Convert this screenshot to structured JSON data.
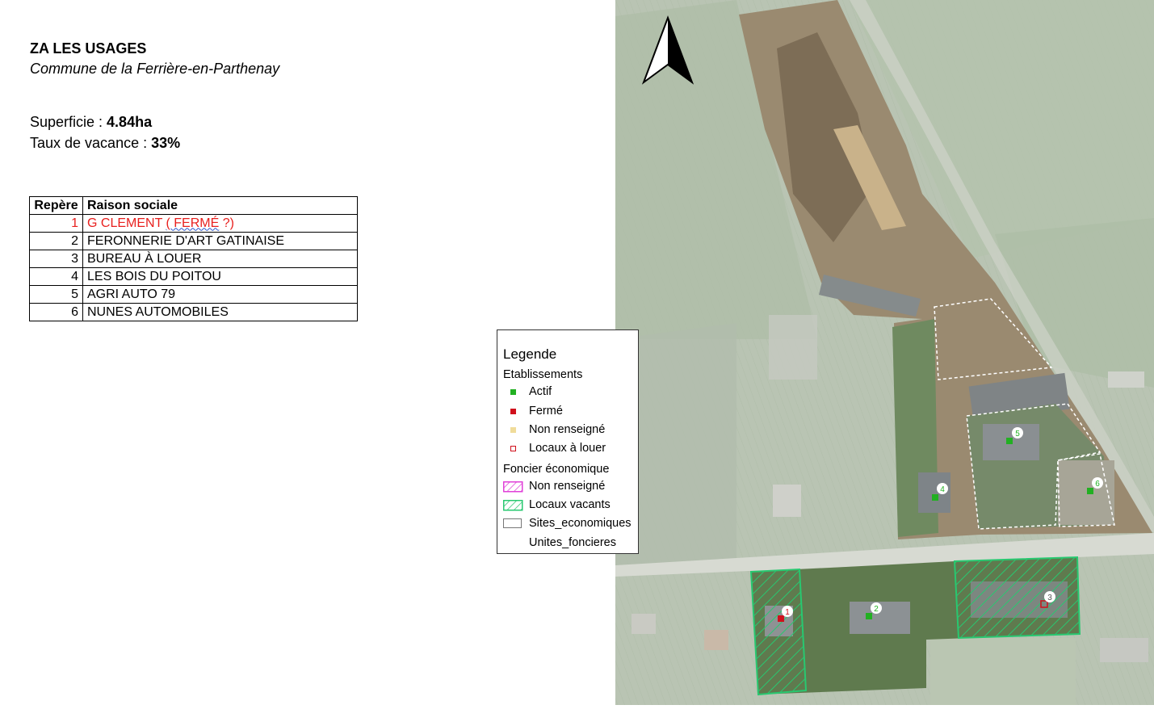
{
  "header": {
    "title": "ZA LES USAGES",
    "subtitle": "Commune de la Ferrière-en-Parthenay"
  },
  "stats": {
    "area_label": "Superficie : ",
    "area_value": "4.84ha",
    "vacancy_label": "Taux de vacance : ",
    "vacancy_value": "33%"
  },
  "table": {
    "headers": [
      "Repère",
      "Raison sociale"
    ],
    "rows": [
      {
        "num": "1",
        "name_part1": "G CLEMENT ",
        "name_part2": "( FERMÉ",
        "name_part3": " ?)"
      },
      {
        "num": "2",
        "name": "FERONNERIE D'ART GATINAISE"
      },
      {
        "num": "3",
        "name": "BUREAU À LOUER"
      },
      {
        "num": "4",
        "name": "LES BOIS DU POITOU"
      },
      {
        "num": "5",
        "name": "AGRI AUTO 79"
      },
      {
        "num": "6",
        "name": "NUNES AUTOMOBILES"
      }
    ]
  },
  "legend": {
    "title": "Legende",
    "section_establishments": "Etablissements",
    "active": "Actif",
    "closed": "Fermé",
    "not_informed": "Non renseigné",
    "premises_to_let": "Locaux à louer",
    "section_land": "Foncier économique",
    "land_not_informed": "Non renseigné",
    "vacant_premises": "Locaux vacants",
    "economic_sites": "Sites_economiques",
    "land_units": "Unites_foncieres"
  },
  "map": {
    "markers": [
      "1",
      "2",
      "3",
      "4",
      "5",
      "6"
    ]
  },
  "colors": {
    "active": "#22b022",
    "closed": "#d0101c",
    "not_informed": "#f0dc9a",
    "hatch_pink": "#e040d8",
    "hatch_green": "#28c870",
    "table_closed_text": "#e8201e"
  }
}
